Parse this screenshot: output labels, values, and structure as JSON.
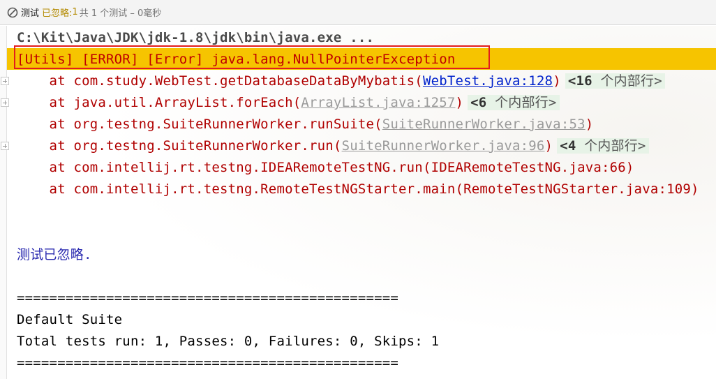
{
  "status": {
    "tab_label": "测试",
    "ignored_label": "已忽略:",
    "count": "1",
    "summary": "共 1 个测试 – 0毫秒"
  },
  "console": {
    "command_line": "C:\\Kit\\Java\\JDK\\jdk-1.8\\jdk\\bin\\java.exe ...",
    "error_line": "[Utils] [ERROR] [Error] java.lang.NullPointerException",
    "stack": [
      {
        "prefix": "    at com.study.WebTest.getDatabaseDataByMybatis(",
        "link": "WebTest.java:128",
        "suffix": ")",
        "fold_count": "<16",
        "fold_text": " 个内部行>"
      },
      {
        "prefix": "    at java.util.ArrayList.forEach(",
        "link": "ArrayList.java:1257",
        "suffix": ")",
        "fold_count": "<6",
        "fold_text": " 个内部行>"
      },
      {
        "prefix": "    at org.testng.SuiteRunnerWorker.runSuite(",
        "link": "SuiteRunnerWorker.java:53",
        "suffix": ")"
      },
      {
        "prefix": "    at org.testng.SuiteRunnerWorker.run(",
        "link": "SuiteRunnerWorker.java:96",
        "suffix": ")",
        "fold_count": "<4",
        "fold_text": " 个内部行>"
      },
      {
        "text": "    at com.intellij.rt.testng.IDEARemoteTestNG.run(IDEARemoteTestNG.java:66)"
      },
      {
        "text": "    at com.intellij.rt.testng.RemoteTestNGStarter.main(RemoteTestNGStarter.java:109)"
      }
    ],
    "skipped_message": "测试已忽略.",
    "separator": "===============================================",
    "suite_name": "Default Suite",
    "totals": "Total tests run: 1, Passes: 0, Failures: 0, Skips: 1",
    "separator2": "==============================================="
  },
  "colors": {
    "error_band": "#f6c400",
    "error_box": "#e21d1d",
    "error_text": "#bf0000",
    "link": "#0022cc",
    "fold_bg": "#e7f3e7"
  }
}
